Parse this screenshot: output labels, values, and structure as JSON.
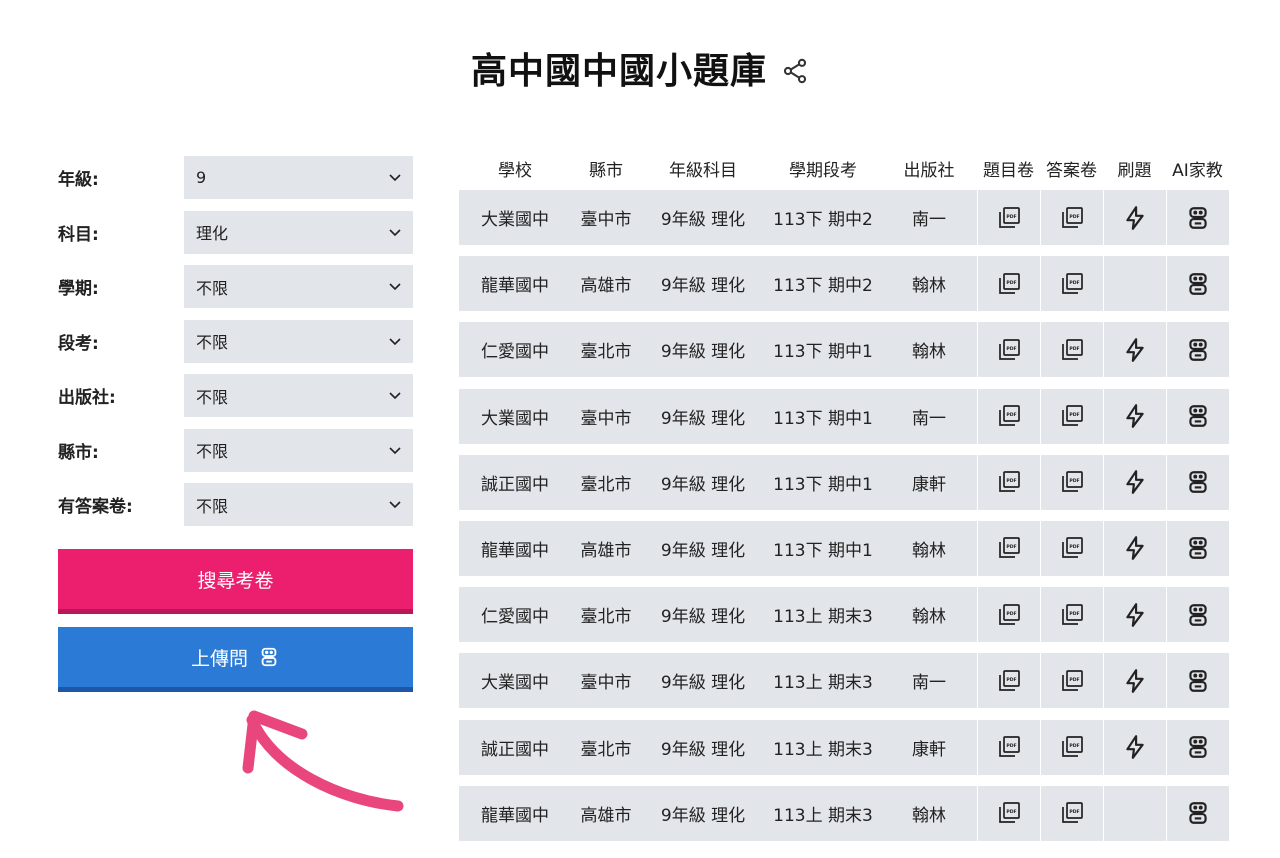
{
  "page": {
    "title": "高中國中國小題庫"
  },
  "filters": [
    {
      "label": "年級:",
      "value": "9"
    },
    {
      "label": "科目:",
      "value": "理化"
    },
    {
      "label": "學期:",
      "value": "不限"
    },
    {
      "label": "段考:",
      "value": "不限"
    },
    {
      "label": "出版社:",
      "value": "不限"
    },
    {
      "label": "縣市:",
      "value": "不限"
    },
    {
      "label": "有答案卷:",
      "value": "不限"
    }
  ],
  "buttons": {
    "search": "搜尋考卷",
    "upload": "上傳問"
  },
  "colors": {
    "search_button": "#ec1f6e",
    "upload_button": "#2b7bd6",
    "arrow": "#e8467c",
    "cell_bg": "#e2e5ea"
  },
  "table": {
    "headers": [
      "學校",
      "縣市",
      "年級科目",
      "學期段考",
      "出版社",
      "題目卷",
      "答案卷",
      "刷題",
      "AI家教"
    ],
    "rows": [
      {
        "school": "大業國中",
        "city": "臺中市",
        "grade": "9年級 理化",
        "term": "113下 期中2",
        "publisher": "南一",
        "quiz": true
      },
      {
        "school": "龍華國中",
        "city": "高雄市",
        "grade": "9年級 理化",
        "term": "113下 期中2",
        "publisher": "翰林",
        "quiz": false
      },
      {
        "school": "仁愛國中",
        "city": "臺北市",
        "grade": "9年級 理化",
        "term": "113下 期中1",
        "publisher": "翰林",
        "quiz": true
      },
      {
        "school": "大業國中",
        "city": "臺中市",
        "grade": "9年級 理化",
        "term": "113下 期中1",
        "publisher": "南一",
        "quiz": true
      },
      {
        "school": "誠正國中",
        "city": "臺北市",
        "grade": "9年級 理化",
        "term": "113下 期中1",
        "publisher": "康軒",
        "quiz": true
      },
      {
        "school": "龍華國中",
        "city": "高雄市",
        "grade": "9年級 理化",
        "term": "113下 期中1",
        "publisher": "翰林",
        "quiz": true
      },
      {
        "school": "仁愛國中",
        "city": "臺北市",
        "grade": "9年級 理化",
        "term": "113上 期末3",
        "publisher": "翰林",
        "quiz": true
      },
      {
        "school": "大業國中",
        "city": "臺中市",
        "grade": "9年級 理化",
        "term": "113上 期末3",
        "publisher": "南一",
        "quiz": true
      },
      {
        "school": "誠正國中",
        "city": "臺北市",
        "grade": "9年級 理化",
        "term": "113上 期末3",
        "publisher": "康軒",
        "quiz": true
      },
      {
        "school": "龍華國中",
        "city": "高雄市",
        "grade": "9年級 理化",
        "term": "113上 期末3",
        "publisher": "翰林",
        "quiz": false
      }
    ]
  },
  "icons": {
    "share": "share-icon",
    "chevron": "chevron-down-icon",
    "pdf": "pdf-icon",
    "bolt": "lightning-icon",
    "robot": "robot-icon"
  }
}
